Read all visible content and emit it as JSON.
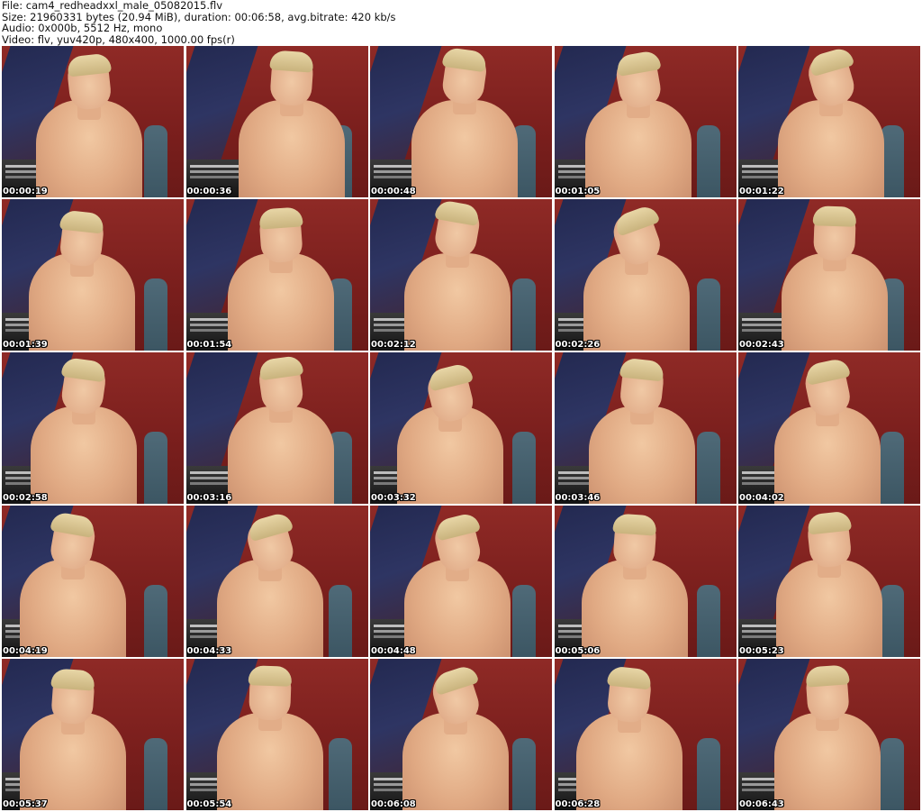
{
  "info": {
    "file_line": "File: cam4_redheadxxl_male_05082015.flv",
    "size_line": "Size: 21960331 bytes (20.94 MiB), duration: 00:06:58, avg.bitrate: 420 kb/s",
    "audio_line": "Audio: 0x000b, 5512 Hz, mono",
    "video_line": "Video: flv, yuv420p, 480x400, 1000.00 fps(r)"
  },
  "thumbnails": [
    {
      "timestamp": "00:00:19"
    },
    {
      "timestamp": "00:00:36"
    },
    {
      "timestamp": "00:00:48"
    },
    {
      "timestamp": "00:01:05"
    },
    {
      "timestamp": "00:01:22"
    },
    {
      "timestamp": "00:01:39"
    },
    {
      "timestamp": "00:01:54"
    },
    {
      "timestamp": "00:02:12"
    },
    {
      "timestamp": "00:02:26"
    },
    {
      "timestamp": "00:02:43"
    },
    {
      "timestamp": "00:02:58"
    },
    {
      "timestamp": "00:03:16"
    },
    {
      "timestamp": "00:03:32"
    },
    {
      "timestamp": "00:03:46"
    },
    {
      "timestamp": "00:04:02"
    },
    {
      "timestamp": "00:04:19"
    },
    {
      "timestamp": "00:04:33"
    },
    {
      "timestamp": "00:04:48"
    },
    {
      "timestamp": "00:05:06"
    },
    {
      "timestamp": "00:05:23"
    },
    {
      "timestamp": "00:05:37"
    },
    {
      "timestamp": "00:05:54"
    },
    {
      "timestamp": "00:06:08"
    },
    {
      "timestamp": "00:06:28"
    },
    {
      "timestamp": "00:06:43"
    }
  ],
  "colors": {
    "background": "#ffffff",
    "header_text": "#111111",
    "timestamp_text": "#ffffff",
    "timestamp_outline": "#000000"
  }
}
